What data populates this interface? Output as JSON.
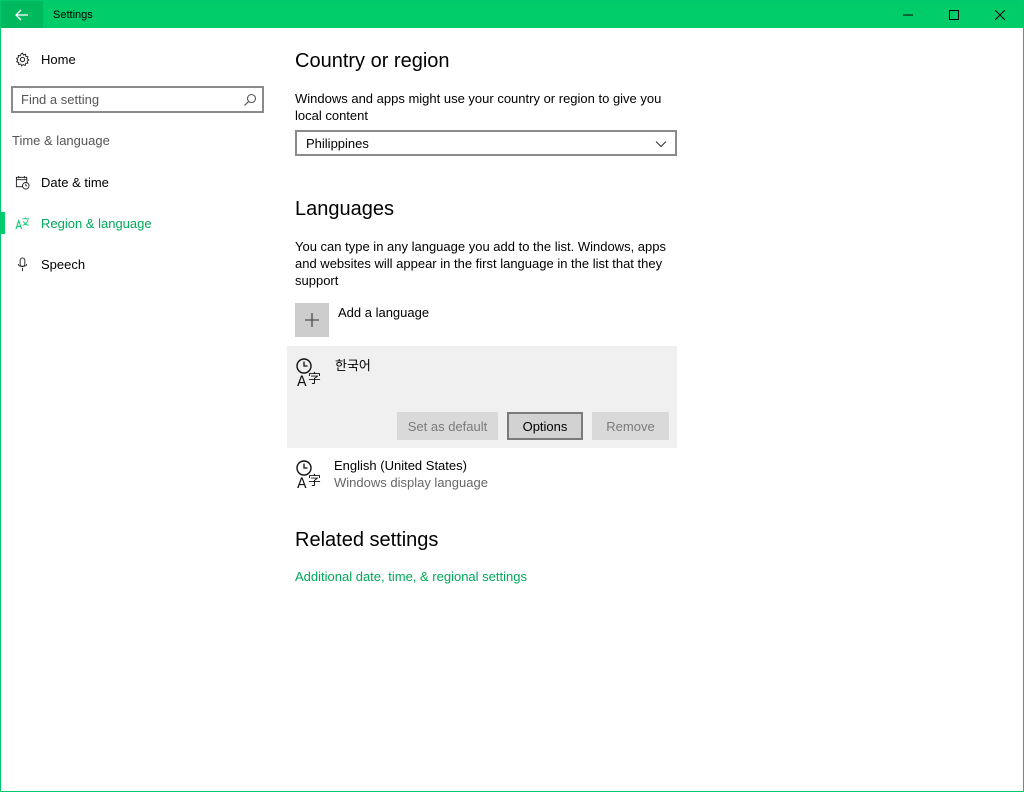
{
  "window": {
    "title": "Settings"
  },
  "sidebar": {
    "home_label": "Home",
    "search_placeholder": "Find a setting",
    "group_label": "Time & language",
    "items": [
      {
        "label": "Date & time",
        "icon": "calendar-clock-icon"
      },
      {
        "label": "Region & language",
        "icon": "region-language-icon",
        "active": true
      },
      {
        "label": "Speech",
        "icon": "microphone-icon"
      }
    ]
  },
  "country": {
    "heading": "Country or region",
    "description": "Windows and apps might use your country or region to give you local content",
    "selected": "Philippines"
  },
  "languages": {
    "heading": "Languages",
    "description": "You can type in any language you add to the list. Windows, apps and websites will appear in the first language in the list that they support",
    "add_label": "Add a language",
    "list": [
      {
        "name": "한국어",
        "sub": ""
      },
      {
        "name": "English (United States)",
        "sub": "Windows display language"
      }
    ],
    "buttons": {
      "set_default": "Set as default",
      "options": "Options",
      "remove": "Remove"
    }
  },
  "related": {
    "heading": "Related settings",
    "link": "Additional date, time, & regional settings"
  },
  "colors": {
    "accent": "#00cc6a",
    "link": "#00a85a"
  }
}
